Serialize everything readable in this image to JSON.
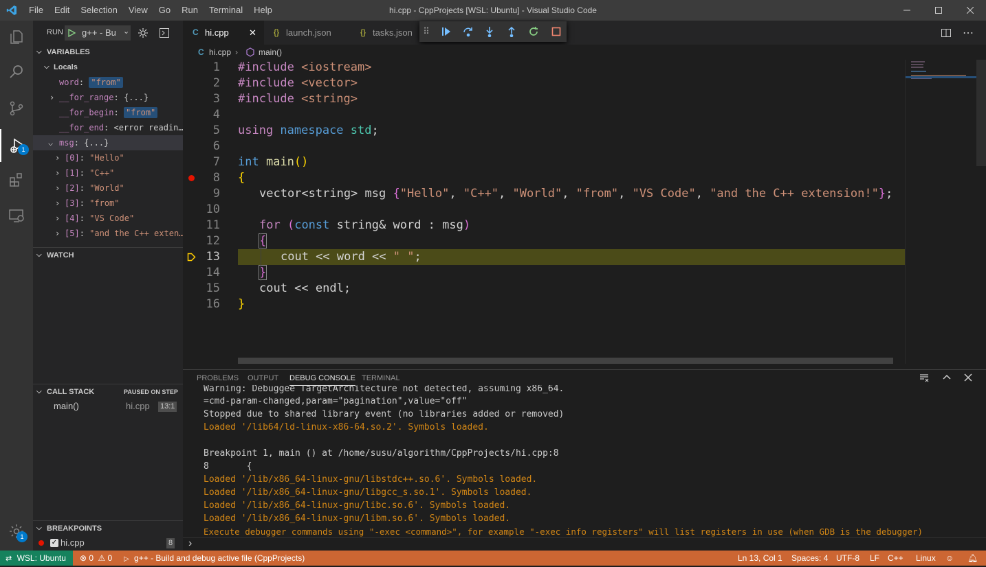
{
  "titlebar": {
    "menu": [
      "File",
      "Edit",
      "Selection",
      "View",
      "Go",
      "Run",
      "Terminal",
      "Help"
    ],
    "title": "hi.cpp - CppProjects [WSL: Ubuntu] - Visual Studio Code"
  },
  "activity": {
    "debug_badge": "1",
    "settings_badge": "1"
  },
  "run": {
    "label": "RUN",
    "config": "g++ - Bu"
  },
  "variables": {
    "header": "VARIABLES",
    "locals_label": "Locals",
    "rows": [
      {
        "name": "word",
        "value": "\"from\""
      },
      {
        "name": "__for_range",
        "value": "{...}"
      },
      {
        "name": "__for_begin",
        "value": "\"from\""
      },
      {
        "name": "__for_end",
        "value": "<error readin…"
      },
      {
        "name": "msg",
        "value": "{...}"
      },
      {
        "name": "[0]",
        "value": "\"Hello\""
      },
      {
        "name": "[1]",
        "value": "\"C++\""
      },
      {
        "name": "[2]",
        "value": "\"World\""
      },
      {
        "name": "[3]",
        "value": "\"from\""
      },
      {
        "name": "[4]",
        "value": "\"VS Code\""
      },
      {
        "name": "[5]",
        "value": "\"and the C++ exten…"
      }
    ]
  },
  "watch": {
    "header": "WATCH"
  },
  "callstack": {
    "header": "CALL STACK",
    "status": "PAUSED ON STEP",
    "frame": "main()",
    "file": "hi.cpp",
    "pos": "13:1"
  },
  "breakpoints": {
    "header": "BREAKPOINTS",
    "file": "hi.cpp",
    "count": "8"
  },
  "tabs": [
    {
      "label": "hi.cpp",
      "icon": "C"
    },
    {
      "label": "launch.json",
      "icon": "{}"
    },
    {
      "label": "tasks.json",
      "icon": "{}"
    }
  ],
  "breadcrumb": {
    "file": "hi.cpp",
    "symbol": "main()"
  },
  "editor": {
    "line_numbers": [
      "1",
      "2",
      "3",
      "4",
      "5",
      "6",
      "7",
      "8",
      "9",
      "10",
      "11",
      "12",
      "13",
      "14",
      "15",
      "16"
    ],
    "l1": {
      "a": "#include ",
      "b": "<iostream>"
    },
    "l2": {
      "a": "#include ",
      "b": "<vector>"
    },
    "l3": {
      "a": "#include ",
      "b": "<string>"
    },
    "l5": {
      "a": "using ",
      "b": "namespace ",
      "c": "std",
      "d": ";"
    },
    "l7": {
      "a": "int ",
      "b": "main",
      "c": "()"
    },
    "l8": "{",
    "l9": {
      "a": "vector<string> msg ",
      "b": "{",
      "s1": "\"Hello\"",
      "s2": "\"C++\"",
      "s3": "\"World\"",
      "s4": "\"from\"",
      "s5": "\"VS Code\"",
      "s6": "\"and the C++ extension!\"",
      "sep": ", ",
      "c": "}",
      "d": ";"
    },
    "l11": {
      "a": "for ",
      "b": "(",
      "c": "const ",
      "d": "string& word : msg",
      "e": ")"
    },
    "l12": "{",
    "l13": {
      "a": "cout << word << ",
      "b": "\" \"",
      "c": ";"
    },
    "l14": "}",
    "l15": "cout << endl;",
    "l16": "}"
  },
  "panel": {
    "tabs": [
      "PROBLEMS",
      "OUTPUT",
      "DEBUG CONSOLE",
      "TERMINAL"
    ],
    "console": [
      {
        "text": "Warning: Debuggee TargetArchitecture not detected, assuming x86_64.",
        "color": "#cccccc"
      },
      {
        "text": "=cmd-param-changed,param=\"pagination\",value=\"off\"",
        "color": "#cccccc"
      },
      {
        "text": "Stopped due to shared library event (no libraries added or removed)",
        "color": "#cccccc"
      },
      {
        "text": "Loaded '/lib64/ld-linux-x86-64.so.2'. Symbols loaded.",
        "color": "#d18616"
      },
      {
        "text": "",
        "color": "#cccccc"
      },
      {
        "text": "Breakpoint 1, main () at /home/susu/algorithm/CppProjects/hi.cpp:8",
        "color": "#cccccc"
      },
      {
        "text": "8       {",
        "color": "#cccccc"
      },
      {
        "text": "Loaded '/lib/x86_64-linux-gnu/libstdc++.so.6'. Symbols loaded.",
        "color": "#d18616"
      },
      {
        "text": "Loaded '/lib/x86_64-linux-gnu/libgcc_s.so.1'. Symbols loaded.",
        "color": "#d18616"
      },
      {
        "text": "Loaded '/lib/x86_64-linux-gnu/libc.so.6'. Symbols loaded.",
        "color": "#d18616"
      },
      {
        "text": "Loaded '/lib/x86_64-linux-gnu/libm.so.6'. Symbols loaded.",
        "color": "#d18616"
      },
      {
        "text": "Execute debugger commands using \"-exec <command>\", for example \"-exec info registers\" will list registers in use (when GDB is the debugger)",
        "color": "#d18616"
      }
    ],
    "prompt": "›"
  },
  "status": {
    "remote": "WSL: Ubuntu",
    "errors": "0",
    "warnings": "0",
    "debug": "g++ - Build and debug active file (CppProjects)",
    "position": "Ln 13, Col 1",
    "spaces": "Spaces: 4",
    "encoding": "UTF-8",
    "eol": "LF",
    "language": "C++",
    "os": "Linux"
  },
  "colors": {
    "statusbar": "#cc6633",
    "accent": "#007acc",
    "current_line": "#4b4b18"
  }
}
